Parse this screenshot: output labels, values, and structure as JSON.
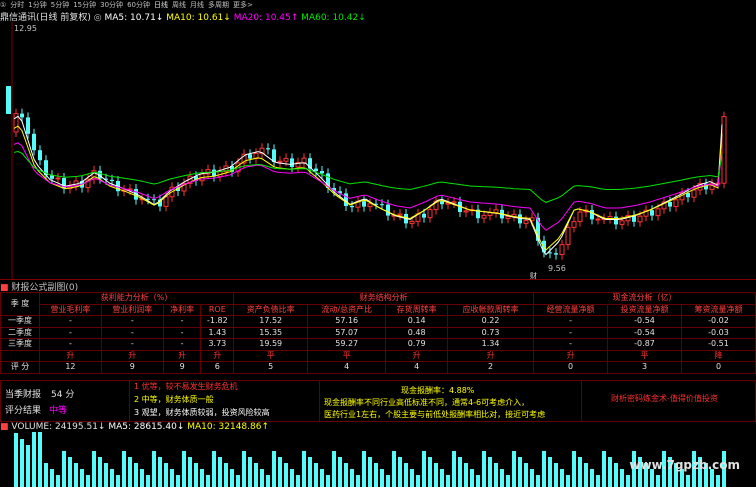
{
  "toolbar": {
    "items": [
      "①",
      "分时",
      "1分钟",
      "5分钟",
      "15分钟",
      "30分钟",
      "60分钟",
      "日线",
      "周线",
      "月线",
      "多周期",
      "更多>"
    ],
    "active_index": 7
  },
  "chart": {
    "stock_name": "鼎信通讯(日线 前复权)",
    "ma5_label": "MA5: 10.71",
    "ma10_label": "MA10: 10.61",
    "ma20_label": "MA20: 10.45",
    "ma60_label": "MA60: 10.42",
    "high_label": "12.95",
    "low_label": "9.56",
    "marker_label": "财",
    "colors": {
      "up": "#ff3232",
      "down": "#54fcfc",
      "ma5": "#ffffff",
      "ma10": "#ffff00",
      "ma20": "#ff00ff",
      "ma60": "#00e600"
    }
  },
  "panel": {
    "title": "财报公式副图(0)"
  },
  "fin_table": {
    "groups": [
      "获利能力分析（%）",
      "财务结构分析",
      "现金流分析（亿）"
    ],
    "season_label": "季  度",
    "headers": [
      "营业毛利率",
      "营业利润率",
      "净利率",
      "ROE",
      "资产负债比率",
      "流动/总资产比",
      "存货周转率",
      "应收帐款周转率",
      "经营流量净额",
      "投资流量净额",
      "筹资流量净额"
    ],
    "rows": [
      {
        "label": "一季度",
        "cells": [
          "-",
          "-",
          "-",
          "-1.82",
          "17.52",
          "57.16",
          "0.14",
          "0.22",
          "-",
          "-0.54",
          "-0.02"
        ]
      },
      {
        "label": "二季度",
        "cells": [
          "-",
          "-",
          "-",
          "1.43",
          "15.35",
          "57.07",
          "0.48",
          "0.73",
          "-",
          "-0.54",
          "-0.03"
        ]
      },
      {
        "label": "三季度",
        "cells": [
          "-",
          "-",
          "-",
          "3.73",
          "19.59",
          "59.27",
          "0.79",
          "1.34",
          "-",
          "-0.87",
          "-0.51"
        ]
      }
    ],
    "levels": [
      "升",
      "升",
      "升",
      "升",
      "平",
      "平",
      "升",
      "升",
      "升",
      "平",
      "降"
    ],
    "score_label": "评  分",
    "scores": [
      "12",
      "9",
      "9",
      "6",
      "5",
      "4",
      "4",
      "2",
      "0",
      "3",
      "0"
    ]
  },
  "evaluation": {
    "current_label": "当季财报",
    "current_score": "54  分",
    "result_label": "评分结果",
    "result_value": "中等",
    "notes": [
      "1 优等，较不易发生财务危机",
      "2 中等，财务体质一般",
      "3 观望，财务体质较弱，投资风险较高"
    ],
    "reward_title": "现金报酬率：4.88%",
    "reward_lines": [
      "现金报酬率不同行业高低标准不同，通常4-6可考虑介入，",
      "医药行业1左右，个股主要与前低处报酬率相比对，接近可考虑"
    ],
    "right_text": "财析密码炼金术-值得价值投资"
  },
  "volume": {
    "vol_label": "VOLUME: 24195.51",
    "ma5_label": "MA5: 28615.40",
    "ma10_label": "MA10: 32148.86"
  },
  "watermark": "www.7gpzb.com"
}
